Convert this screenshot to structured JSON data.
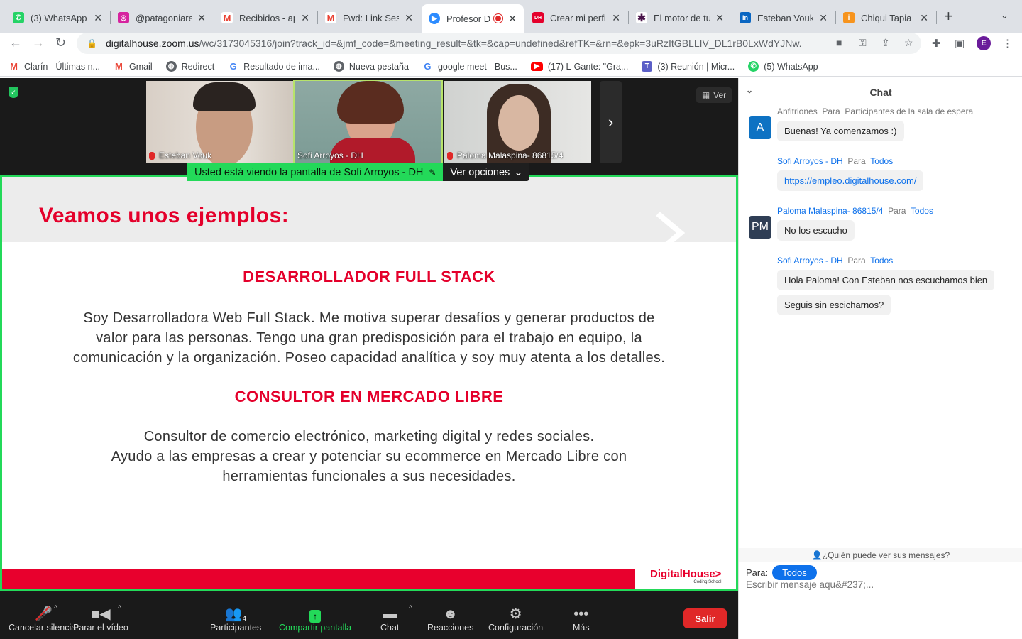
{
  "browser": {
    "tabs": [
      {
        "title": "(3) WhatsApp",
        "icon": "whatsapp-icon",
        "color": "#25d366"
      },
      {
        "title": "@patagoniarec",
        "icon": "instagram-icon",
        "color": "#d6249f"
      },
      {
        "title": "Recibidos - ap",
        "icon": "gmail-icon",
        "color": "#ea4335"
      },
      {
        "title": "Fwd: Link Sesi",
        "icon": "gmail-icon",
        "color": "#ea4335"
      },
      {
        "title": "Profesor D",
        "icon": "zoom-icon",
        "color": "#2d8cff"
      },
      {
        "title": "Crear mi perfil",
        "icon": "digitalhouse-icon",
        "color": "#e4002b"
      },
      {
        "title": "El motor de tu",
        "icon": "slack-icon",
        "color": "#4a154b"
      },
      {
        "title": "Esteban Vouk",
        "icon": "linkedin-icon",
        "color": "#0a66c2"
      },
      {
        "title": "Chiqui Tapia h",
        "icon": "infobae-icon",
        "color": "#f7941d"
      }
    ],
    "new_tab": "+",
    "url_host": "digitalhouse.zoom.us",
    "url_path": "/wc/3173045316/join?track_id=&jmf_code=&meeting_result=&tk=&cap=undefined&refTK=&rn=&epk=3uRzItGBLLIV_DL1rB0LxWdYJNw...",
    "profile_initial": "E",
    "bookmarks": [
      {
        "label": "Clarín - Últimas n...",
        "icon": "gmail-icon",
        "color": "#ea4335"
      },
      {
        "label": "Gmail",
        "icon": "gmail-icon",
        "color": "#ea4335"
      },
      {
        "label": "Redirect",
        "icon": "globe-icon",
        "color": "#5f6368"
      },
      {
        "label": "Resultado de ima...",
        "icon": "google-icon",
        "color": "#4285f4"
      },
      {
        "label": "Nueva pestaña",
        "icon": "globe-icon",
        "color": "#5f6368"
      },
      {
        "label": "google meet - Bus...",
        "icon": "google-icon",
        "color": "#4285f4"
      },
      {
        "label": "(17) L-Gante: \"Gra...",
        "icon": "youtube-icon",
        "color": "#ff0000"
      },
      {
        "label": "(3) Reunión | Micr...",
        "icon": "teams-icon",
        "color": "#5b5fc7"
      },
      {
        "label": "(5) WhatsApp",
        "icon": "whatsapp-icon",
        "color": "#25d366"
      }
    ]
  },
  "meeting": {
    "participants_video": [
      {
        "name": "Esteban Vouk",
        "muted": true
      },
      {
        "name": "Sofi Arroyos - DH",
        "muted": false
      },
      {
        "name": "Paloma Malaspina- 86815/4",
        "muted": true
      }
    ],
    "view_button": "Ver",
    "banner_text": "Usted está viendo la pantalla de Sofi Arroyos - DH",
    "banner_options": "Ver opciones",
    "slide": {
      "title": "Veamos unos ejemplos:",
      "section1_heading": "DESARROLLADOR FULL STACK",
      "section1_lines": [
        "Soy Desarrolladora Web Full Stack. Me motiva superar desafíos y generar productos de",
        "valor para las personas. Tengo una gran predisposición para el trabajo en equipo, la",
        "comunicación y la organización. Poseo capacidad analítica y soy muy atenta a los detalles."
      ],
      "section2_heading": "CONSULTOR EN MERCADO LIBRE",
      "section2_lines": [
        "Consultor de comercio electrónico, marketing digital y redes sociales.",
        "Ayudo a las empresas a crear y potenciar su ecommerce en Mercado Libre con",
        "herramientas funcionales a sus necesidades."
      ],
      "logo_text": "DigitalHouse>",
      "logo_sub": "Coding School"
    },
    "toolbar": {
      "mute": "Cancelar silenciar",
      "video": "Parar el vídeo",
      "participants": "Participantes",
      "participants_count": "4",
      "share": "Compartir pantalla",
      "chat": "Chat",
      "reactions": "Reacciones",
      "settings": "Configuración",
      "more": "Más",
      "leave": "Salir"
    }
  },
  "chat": {
    "title": "Chat",
    "messages": [
      {
        "from": "Anfitriones",
        "to_word": "Para",
        "to": "Participantes de la sala de espera",
        "text": "Buenas! Ya comenzamos :)",
        "avatar": "A",
        "avatar_color": "#0e72c3"
      },
      {
        "from": "Sofi Arroyos - DH",
        "to_word": "Para",
        "to": "Todos",
        "text": "https://empleo.digitalhouse.com/"
      },
      {
        "from": "Paloma Malaspina- 86815/4",
        "to_word": "Para",
        "to": "Todos",
        "text": "No los escucho",
        "avatar": "PM",
        "avatar_color": "#2f3e55"
      },
      {
        "from": "Sofi Arroyos - DH",
        "to_word": "Para",
        "to": "Todos",
        "text": "Hola Paloma! Con Esteban nos escuchamos bien",
        "text2": "Seguis sin escicharnos?"
      }
    ],
    "who_can_see": "¿Quién puede ver sus mensajes?",
    "to_label": "Para:",
    "to_value": "Todos",
    "input_placeholder": "Escribir mensaje aqu&#237;..."
  }
}
